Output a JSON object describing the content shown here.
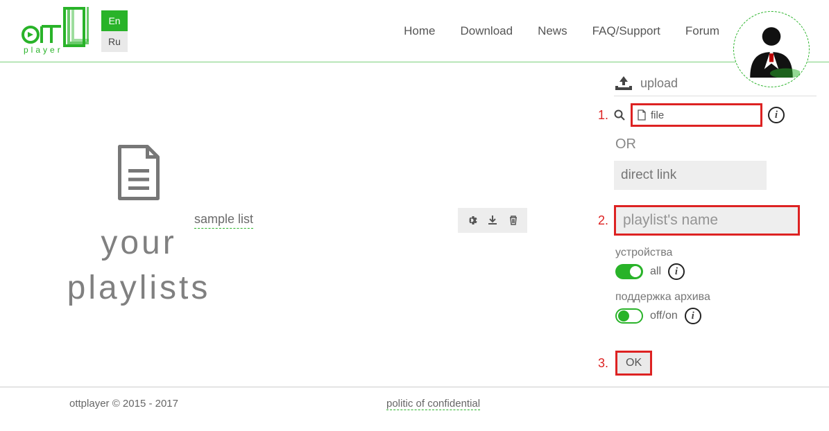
{
  "lang": {
    "en": "En",
    "ru": "Ru"
  },
  "nav": {
    "home": "Home",
    "download": "Download",
    "news": "News",
    "faq": "FAQ/Support",
    "forum": "Forum"
  },
  "left": {
    "line1": "your",
    "line2": "playlists"
  },
  "sample": {
    "label": "sample list"
  },
  "upload": {
    "label": "upload",
    "step1": "1.",
    "file_label": "file",
    "or": "OR",
    "direct_link_placeholder": "direct link",
    "step2": "2.",
    "name_placeholder": "playlist's name",
    "devices_label": "устройства",
    "devices_all": "all",
    "archive_label": "поддержка архива",
    "archive_toggle": "off/on",
    "step3": "3.",
    "ok": "OK"
  },
  "footer": {
    "copyright": "ottplayer © 2015 - 2017",
    "policy": "politic of confidential"
  }
}
